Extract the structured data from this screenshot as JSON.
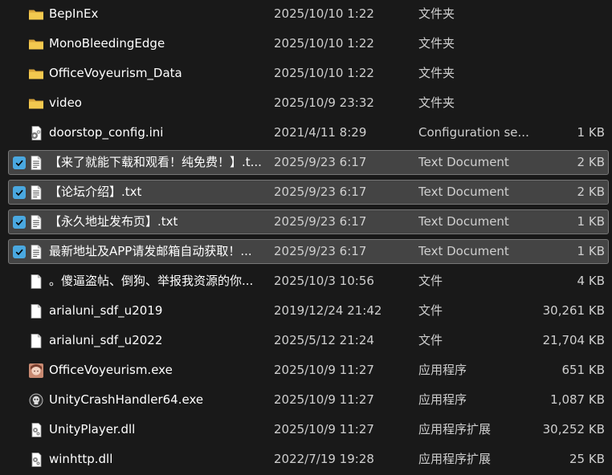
{
  "files": [
    {
      "name": "BepInEx",
      "date": "2025/10/10 1:22",
      "type": "文件夹",
      "size": "",
      "icon": "folder-icon",
      "selected": false
    },
    {
      "name": "MonoBleedingEdge",
      "date": "2025/10/10 1:22",
      "type": "文件夹",
      "size": "",
      "icon": "folder-icon",
      "selected": false
    },
    {
      "name": "OfficeVoyeurism_Data",
      "date": "2025/10/10 1:22",
      "type": "文件夹",
      "size": "",
      "icon": "folder-icon",
      "selected": false
    },
    {
      "name": "video",
      "date": "2025/10/9 23:32",
      "type": "文件夹",
      "size": "",
      "icon": "folder-icon",
      "selected": false
    },
    {
      "name": "doorstop_config.ini",
      "date": "2021/4/11 8:29",
      "type": "Configuration se...",
      "size": "1 KB",
      "icon": "config-file-icon",
      "selected": false
    },
    {
      "name": "【来了就能下载和观看！纯免费！】.t...",
      "date": "2025/9/23 6:17",
      "type": "Text Document",
      "size": "2 KB",
      "icon": "text-document-icon",
      "selected": true
    },
    {
      "name": "【论坛介绍】.txt",
      "date": "2025/9/23 6:17",
      "type": "Text Document",
      "size": "2 KB",
      "icon": "text-document-icon",
      "selected": true
    },
    {
      "name": "【永久地址发布页】.txt",
      "date": "2025/9/23 6:17",
      "type": "Text Document",
      "size": "1 KB",
      "icon": "text-document-icon",
      "selected": true
    },
    {
      "name": "最新地址及APP请发邮箱自动获取！...",
      "date": "2025/9/23 6:17",
      "type": "Text Document",
      "size": "1 KB",
      "icon": "text-document-icon",
      "selected": true
    },
    {
      "name": "。傻逼盗帖、倒狗、举报我资源的你...",
      "date": "2025/10/3 10:56",
      "type": "文件",
      "size": "4 KB",
      "icon": "blank-file-icon",
      "selected": false
    },
    {
      "name": "arialuni_sdf_u2019",
      "date": "2019/12/24 21:42",
      "type": "文件",
      "size": "30,261 KB",
      "icon": "blank-file-icon",
      "selected": false
    },
    {
      "name": "arialuni_sdf_u2022",
      "date": "2025/5/12 21:24",
      "type": "文件",
      "size": "21,704 KB",
      "icon": "blank-file-icon",
      "selected": false
    },
    {
      "name": "OfficeVoyeurism.exe",
      "date": "2025/10/9 11:27",
      "type": "应用程序",
      "size": "651 KB",
      "icon": "app-avatar-icon",
      "selected": false
    },
    {
      "name": "UnityCrashHandler64.exe",
      "date": "2025/10/9 11:27",
      "type": "应用程序",
      "size": "1,087 KB",
      "icon": "crash-handler-icon",
      "selected": false
    },
    {
      "name": "UnityPlayer.dll",
      "date": "2025/10/9 11:27",
      "type": "应用程序扩展",
      "size": "30,252 KB",
      "icon": "dll-file-icon",
      "selected": false
    },
    {
      "name": "winhttp.dll",
      "date": "2022/7/19 19:28",
      "type": "应用程序扩展",
      "size": "25 KB",
      "icon": "dll-file-icon",
      "selected": false
    }
  ],
  "colors": {
    "background": "#191919",
    "selected_row": "#444444",
    "checkbox_accent": "#4aa8e0",
    "folder": "#f0c24b"
  }
}
